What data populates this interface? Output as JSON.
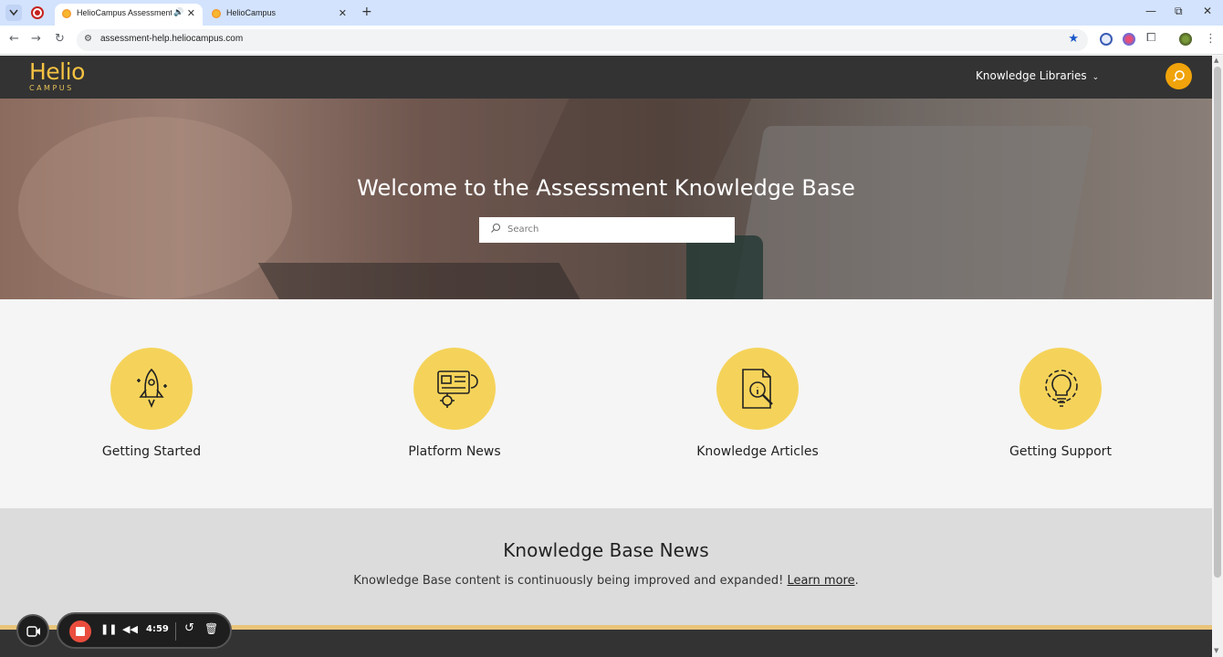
{
  "browser": {
    "tabs": [
      {
        "title": "HelioCampus Assessment K",
        "active": true
      },
      {
        "title": "HelioCampus",
        "active": false
      }
    ],
    "new_tab": "+",
    "url": "assessment-help.heliocampus.com",
    "window_controls": {
      "minimize": "—",
      "restore": "⧉",
      "close": "✕"
    }
  },
  "site": {
    "logo": {
      "line1": "Helio",
      "line2": "CAMPUS"
    },
    "nav": {
      "knowledge_libraries": "Knowledge Libraries"
    },
    "accent_color": "#f0a30a",
    "header_bg": "#333333"
  },
  "hero": {
    "title": "Welcome to the Assessment Knowledge Base",
    "search_placeholder": "Search"
  },
  "features": [
    {
      "label": "Getting Started",
      "icon": "rocket-icon"
    },
    {
      "label": "Platform News",
      "icon": "news-gear-icon"
    },
    {
      "label": "Knowledge Articles",
      "icon": "document-magnifier-icon"
    },
    {
      "label": "Getting Support",
      "icon": "lightbulb-gear-icon"
    }
  ],
  "news": {
    "title": "Knowledge Base News",
    "text": "Knowledge Base content is continuously being improved and expanded! ",
    "link": "Learn more",
    "end": "."
  },
  "recorder": {
    "time": "4:59"
  }
}
